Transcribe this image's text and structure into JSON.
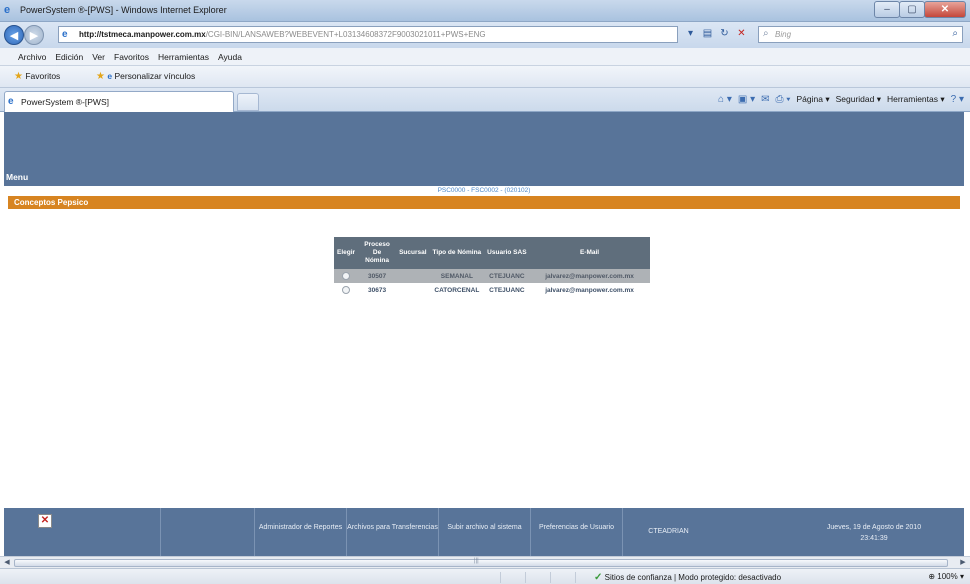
{
  "window": {
    "title": "PowerSystem ®-[PWS] - Windows Internet Explorer"
  },
  "address": {
    "url_host": "http://tstmeca.manpower.com.mx",
    "url_path": "/CGI-BIN/LANSAWEB?WEBEVENT+L03134608372F9003021011+PWS+ENG",
    "search_placeholder": "Bing"
  },
  "menubar": {
    "items": [
      "Archivo",
      "Edición",
      "Ver",
      "Favoritos",
      "Herramientas",
      "Ayuda"
    ]
  },
  "favorites": {
    "favorites_label": "Favoritos",
    "custom_links_label": "Personalizar vínculos"
  },
  "tab": {
    "label": "PowerSystem ®-[PWS]"
  },
  "commandbar": {
    "page": "Página ▾",
    "security": "Seguridad ▾",
    "tools": "Herramientas ▾"
  },
  "page": {
    "menu_label": "Menu",
    "info_line": "PSC0000 - FSC0002 - (020102)",
    "section_title": "Conceptos Pepsico",
    "table": {
      "headers": [
        "Elegir",
        "Proceso De Nómina",
        "Sucursal",
        "Tipo de Nómina",
        "Usuario SAS",
        "E-Mail"
      ],
      "rows": [
        {
          "proceso": "30507",
          "sucursal": "",
          "tipo": "SEMANAL",
          "usuario": "CTEJUANC",
          "email": "jalvarez@manpower.com.mx"
        },
        {
          "proceso": "30673",
          "sucursal": "",
          "tipo": "CATORCENAL",
          "usuario": "CTEJUANC",
          "email": "jalvarez@manpower.com.mx"
        }
      ]
    },
    "footer": {
      "reports": "Administrador de Reportes",
      "transfer_files": "Archivos para Transferencias",
      "upload": "Subir archivo al sistema",
      "preferences": "Preferencias de Usuario",
      "user": "CTEADRIAN",
      "date": "Jueves, 19 de Agosto de 2010",
      "time": "23:41:39"
    }
  },
  "statusbar": {
    "zone": "Sitios de confianza | Modo protegido: desactivado",
    "zoom": "100%"
  },
  "colors": {
    "header_blue": "#587499",
    "section_orange": "#d78421",
    "table_header": "#5f6e7c"
  }
}
